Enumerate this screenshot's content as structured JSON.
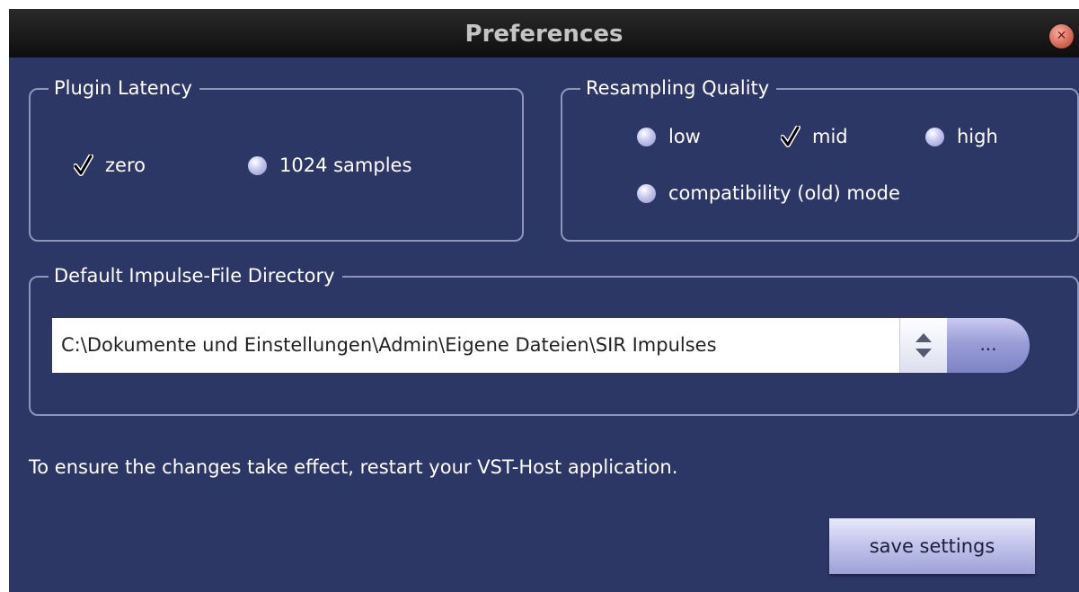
{
  "window": {
    "title": "Preferences"
  },
  "plugin_latency": {
    "label": "Plugin Latency",
    "options": [
      {
        "label": "zero",
        "selected": true
      },
      {
        "label": "1024 samples",
        "selected": false
      }
    ]
  },
  "resampling_quality": {
    "label": "Resampling Quality",
    "options": [
      {
        "label": "low",
        "selected": false
      },
      {
        "label": "mid",
        "selected": true
      },
      {
        "label": "high",
        "selected": false
      },
      {
        "label": "compatibility (old) mode",
        "selected": false
      }
    ]
  },
  "impulse_directory": {
    "label": "Default Impulse-File Directory",
    "path": "C:\\Dokumente und Einstellungen\\Admin\\Eigene Dateien\\SIR Impulses",
    "browse_label": "..."
  },
  "hint": "To ensure the changes take effect, restart your VST-Host application.",
  "save_button": {
    "label": "save settings"
  },
  "colors": {
    "window_background": "#2d3766",
    "titlebar": "#111111",
    "group_border": "#8f95b6",
    "button_face": "#c3c6ec",
    "close_button": "#d96a58"
  },
  "icons": [
    "close-icon",
    "checkmark-icon",
    "radio-dot-icon",
    "up-down-arrows-icon"
  ]
}
